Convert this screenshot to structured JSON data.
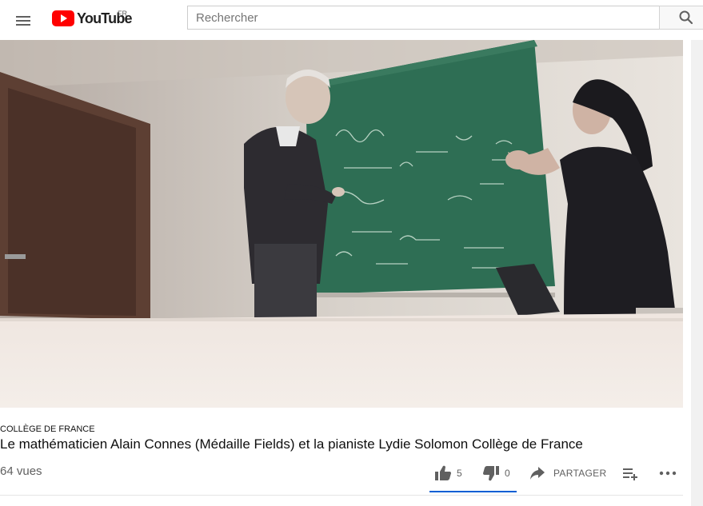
{
  "header": {
    "logo_text": "YouTube",
    "country": "FR",
    "search": {
      "placeholder": "Rechercher",
      "value": ""
    }
  },
  "video": {
    "channel": "COLLÈGE DE FRANCE",
    "title": "Le mathématicien Alain Connes (Médaille Fields) et la pianiste Lydie Solomon Collège de France",
    "views": "64 vues",
    "likes": "5",
    "dislikes": "0",
    "share_label": "PARTAGER",
    "like_ratio": 1.0
  },
  "colors": {
    "brand_red": "#ff0000",
    "link_blue": "#065fd4",
    "icon_gray": "#909090",
    "chalkboard_green": "#2e6e54"
  },
  "icons": [
    "menu-icon",
    "youtube-play-icon",
    "search-icon",
    "thumb-up-icon",
    "thumb-down-icon",
    "share-icon",
    "add-to-playlist-icon",
    "more-icon"
  ]
}
